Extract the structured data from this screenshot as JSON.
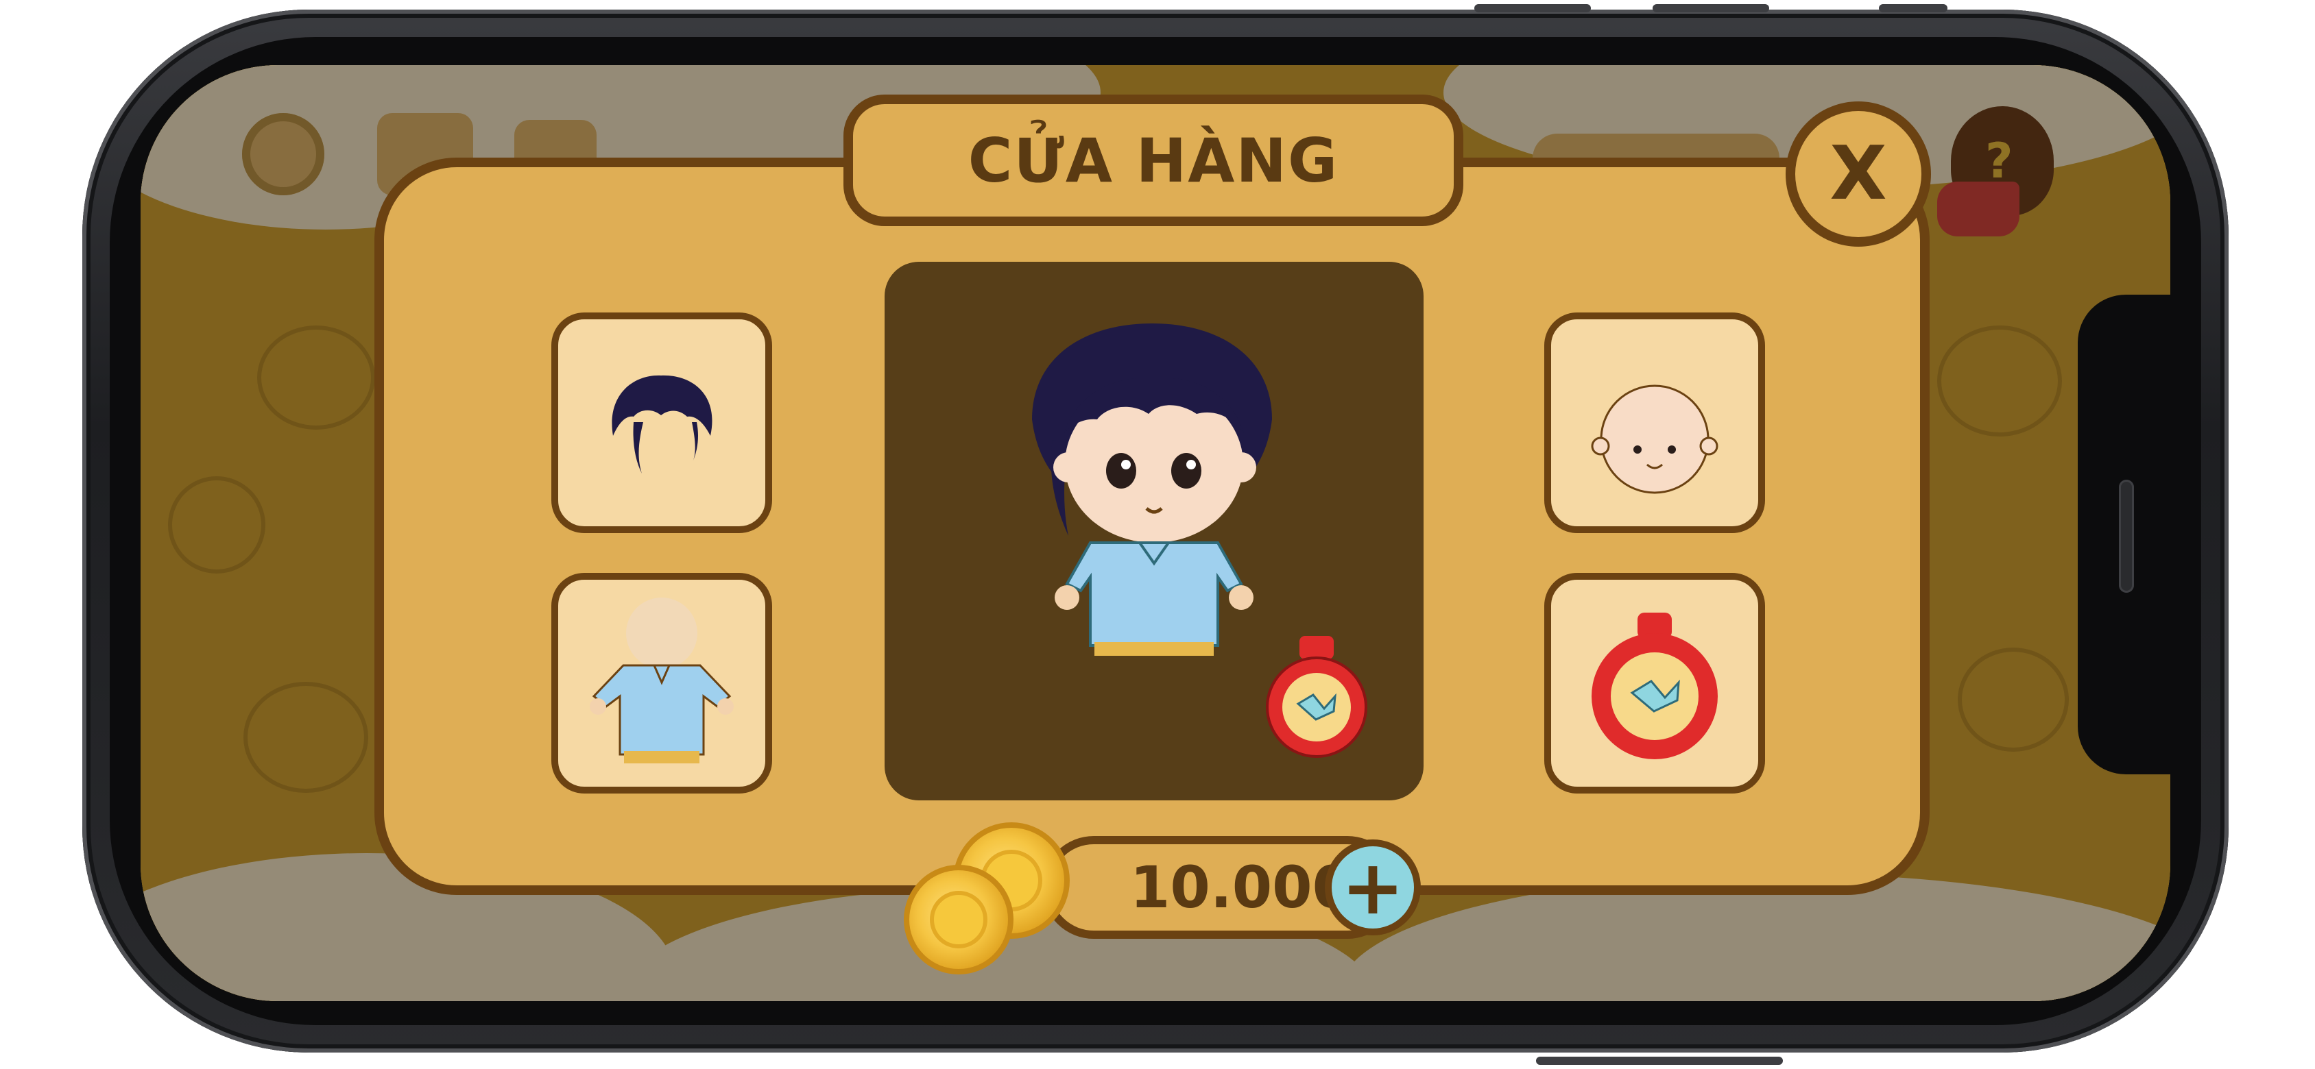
{
  "shop": {
    "title": "CỬA HÀNG",
    "close_label": "X"
  },
  "wallet": {
    "coins": "10.000",
    "add_coins_label": "+"
  },
  "slots": {
    "left": [
      "hair-item",
      "outfit-item"
    ],
    "right": [
      "face-item",
      "potion-item"
    ]
  },
  "icons": {
    "settings": "gear-icon",
    "missions": "scroll-icon",
    "mystery": "mystery-jar-icon",
    "coin": "coin-icon",
    "add": "plus-icon"
  },
  "colors": {
    "panel": "#dfae55",
    "border": "#6b4212",
    "slot": "#f6d9a4",
    "preview": "#573e18",
    "accent_blue": "#8fd6e0"
  }
}
